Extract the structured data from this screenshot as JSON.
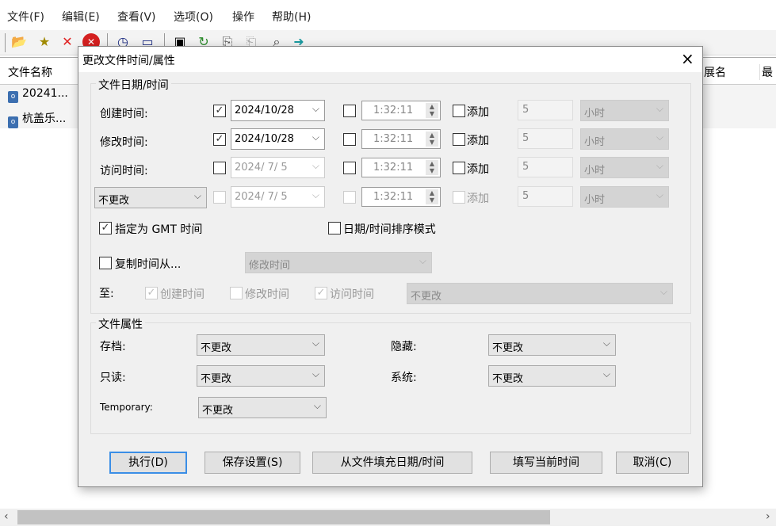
{
  "menu": [
    "文件(F)",
    "编辑(E)",
    "查看(V)",
    "选项(O)",
    "操作",
    "帮助(H)"
  ],
  "toolbar_icons": [
    "open-folder-icon",
    "new-folder-icon",
    "delete-icon",
    "cancel-icon",
    "clock-icon",
    "window-icon",
    "save-icon",
    "refresh-icon",
    "copy-icon",
    "paste-icon",
    "search-icon",
    "exit-icon"
  ],
  "list": {
    "headers": {
      "name": "文件名称",
      "ext": "展名",
      "last": "最"
    },
    "files": [
      "20241...",
      "杭盖乐..."
    ]
  },
  "dialog": {
    "title": "更改文件时间/属性",
    "close": "×",
    "date_group": "文件日期/时间",
    "rows": [
      {
        "label": "创建时间:",
        "checked": true,
        "date": "2024/10/28",
        "time_checked": false,
        "time": "1:32:11",
        "add_label": "添加",
        "add_checked": false,
        "amount": "5",
        "unit": "小时",
        "enabled": true
      },
      {
        "label": "修改时间:",
        "checked": true,
        "date": "2024/10/28",
        "time_checked": false,
        "time": "1:32:11",
        "add_label": "添加",
        "add_checked": false,
        "amount": "5",
        "unit": "小时",
        "enabled": true
      },
      {
        "label": "访问时间:",
        "checked": false,
        "date": "2024/ 7/ 5",
        "time_checked": false,
        "time": "1:32:11",
        "add_label": "添加",
        "add_checked": false,
        "amount": "5",
        "unit": "小时",
        "enabled": true
      },
      {
        "label": "不更改",
        "checked": false,
        "date": "2024/ 7/ 5",
        "time_checked": false,
        "time": "1:32:11",
        "add_label": "添加",
        "add_checked": false,
        "amount": "5",
        "unit": "小时",
        "enabled": false
      }
    ],
    "gmt_label": "指定为 GMT 时间",
    "gmt_checked": true,
    "sort_label": "日期/时间排序模式",
    "sort_checked": false,
    "copy_label": "复制时间从...",
    "copy_checked": false,
    "copy_source": "修改时间",
    "to_label": "至:",
    "to_targets": [
      {
        "label": "创建时间",
        "checked": true
      },
      {
        "label": "修改时间",
        "checked": false
      },
      {
        "label": "访问时间",
        "checked": true
      }
    ],
    "to_mode": "不更改",
    "attr_group": "文件属性",
    "attrs": {
      "archive": {
        "label": "存档:",
        "value": "不更改"
      },
      "readonly": {
        "label": "只读:",
        "value": "不更改"
      },
      "temporary": {
        "label": "Temporary:",
        "value": "不更改"
      },
      "hidden": {
        "label": "隐藏:",
        "value": "不更改"
      },
      "system": {
        "label": "系统:",
        "value": "不更改"
      }
    },
    "buttons": {
      "execute": "执行(D)",
      "save": "保存设置(S)",
      "fill_from_file": "从文件填充日期/时间",
      "fill_now": "填写当前时间",
      "cancel": "取消(C)"
    }
  },
  "scroll": {
    "left": "‹",
    "right": "›"
  }
}
